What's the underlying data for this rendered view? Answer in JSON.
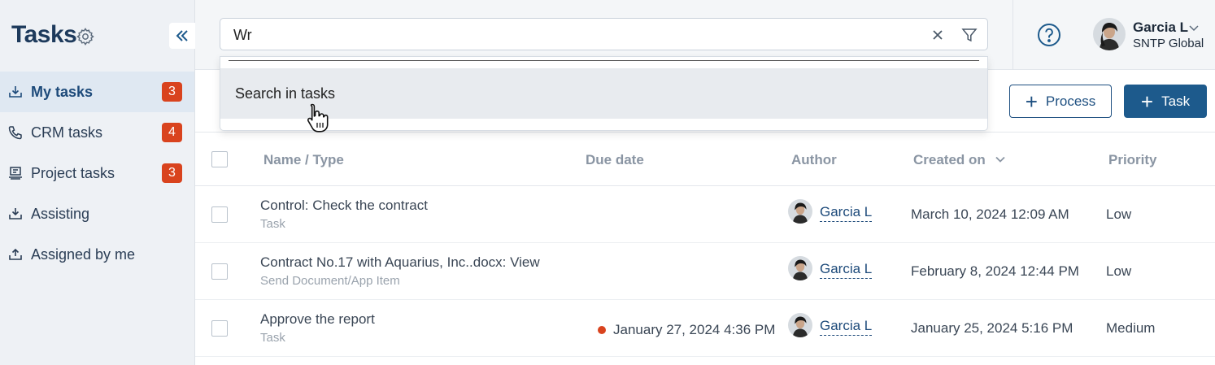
{
  "app": {
    "title": "Tasks"
  },
  "sidebar": {
    "items": [
      {
        "label": "My tasks",
        "badge": "3",
        "icon": "inbox-download-icon",
        "active": true
      },
      {
        "label": "CRM tasks",
        "badge": "4",
        "icon": "phone-icon"
      },
      {
        "label": "Project tasks",
        "badge": "3",
        "icon": "project-board-icon"
      },
      {
        "label": "Assisting",
        "icon": "tray-download-icon"
      },
      {
        "label": "Assigned by me",
        "icon": "tray-upload-icon"
      }
    ]
  },
  "header": {
    "search": {
      "value": "Wr",
      "placeholder": ""
    },
    "user": {
      "name": "Garcia L",
      "org": "SNTP Global"
    }
  },
  "dropdown": {
    "item_label": "Search in tasks"
  },
  "toolbar": {
    "process_label": "Process",
    "task_label": "Task"
  },
  "table": {
    "headers": {
      "name": "Name / Type",
      "due": "Due date",
      "author": "Author",
      "created": "Created on",
      "priority": "Priority"
    },
    "rows": [
      {
        "name": "Control: Check the contract",
        "type": "Task",
        "due": "",
        "author": "Garcia L",
        "created": "March 10, 2024 12:09 AM",
        "priority": "Low"
      },
      {
        "name": "Contract No.17 with Aquarius, Inc..docx: View",
        "type": "Send Document/App Item",
        "due": "",
        "author": "Garcia L",
        "created": "February 8, 2024 12:44 PM",
        "priority": "Low"
      },
      {
        "name": "Approve the report",
        "type": "Task",
        "due": "January 27, 2024 4:36 PM",
        "overdue": true,
        "author": "Garcia L",
        "created": "January 25, 2024 5:16 PM",
        "priority": "Medium"
      }
    ]
  },
  "colors": {
    "accent": "#1d5a8c",
    "badge": "#d9431e",
    "sidebar_bg": "#eef1f5",
    "active_bg": "#dfe8f2"
  }
}
